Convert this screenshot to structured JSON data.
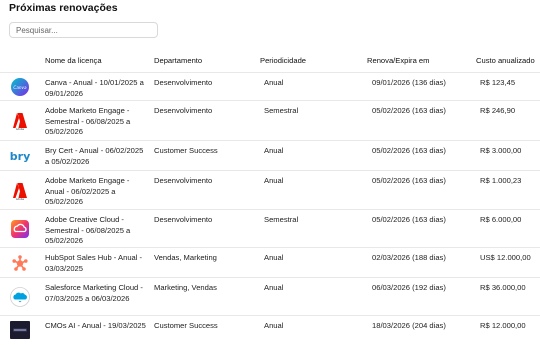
{
  "page": {
    "title": "Próximas renovações"
  },
  "search": {
    "placeholder": "Pesquisar..."
  },
  "columns": {
    "name": "Nome da licença",
    "department": "Departamento",
    "periodicity": "Periodicidade",
    "renewal": "Renova/Expira em",
    "cost": "Custo anualizado"
  },
  "rows": [
    {
      "icon": "canva-icon",
      "name": "Canva - Anual - 10/01/2025 a 09/01/2026",
      "department": "Desenvolvimento",
      "periodicity": "Anual",
      "renewal": "09/01/2026 (136 dias)",
      "cost": "R$ 123,45"
    },
    {
      "icon": "adobe-icon",
      "name": "Adobe Marketo Engage - Semestral - 06/08/2025 a 05/02/2026",
      "department": "Desenvolvimento",
      "periodicity": "Semestral",
      "renewal": "05/02/2026 (163 dias)",
      "cost": "R$ 246,90"
    },
    {
      "icon": "bry-icon",
      "name": "Bry Cert - Anual - 06/02/2025 a 05/02/2026",
      "department": "Customer Success",
      "periodicity": "Anual",
      "renewal": "05/02/2026 (163 dias)",
      "cost": "R$ 3.000,00"
    },
    {
      "icon": "adobe-icon",
      "name": "Adobe Marketo Engage - Anual - 06/02/2025 a 05/02/2026",
      "department": "Desenvolvimento",
      "periodicity": "Anual",
      "renewal": "05/02/2026 (163 dias)",
      "cost": "R$ 1.000,23"
    },
    {
      "icon": "adobe-creative-cloud-icon",
      "name": "Adobe Creative Cloud - Semestral - 06/08/2025 a 05/02/2026",
      "department": "Desenvolvimento",
      "periodicity": "Semestral",
      "renewal": "05/02/2026 (163 dias)",
      "cost": "R$ 6.000,00"
    },
    {
      "icon": "hubspot-icon",
      "name": "HubSpot Sales Hub - Anual - 03/03/2025",
      "department": "Vendas, Marketing",
      "periodicity": "Anual",
      "renewal": "02/03/2026 (188 dias)",
      "cost": "US$ 12.000,00"
    },
    {
      "icon": "salesforce-icon",
      "name": "Salesforce Marketing Cloud - 07/03/2025 a 06/03/2026",
      "department": "Marketing, Vendas",
      "periodicity": "Anual",
      "renewal": "06/03/2026 (192 dias)",
      "cost": "R$ 36.000,00"
    },
    {
      "icon": "cmos-ai-icon",
      "name": "CMOs AI - Anual - 19/03/2025",
      "department": "Customer Success",
      "periodicity": "Anual",
      "renewal": "18/03/2026 (204 dias)",
      "cost": "R$ 12.000,00"
    }
  ],
  "colors": {
    "canva": "#7d2ae8",
    "adobe": "#eb1000",
    "bry": "#1e88c8",
    "hubspot": "#ff7a59",
    "salesforce": "#00a1e0",
    "cmos": "#1c1c2e"
  }
}
